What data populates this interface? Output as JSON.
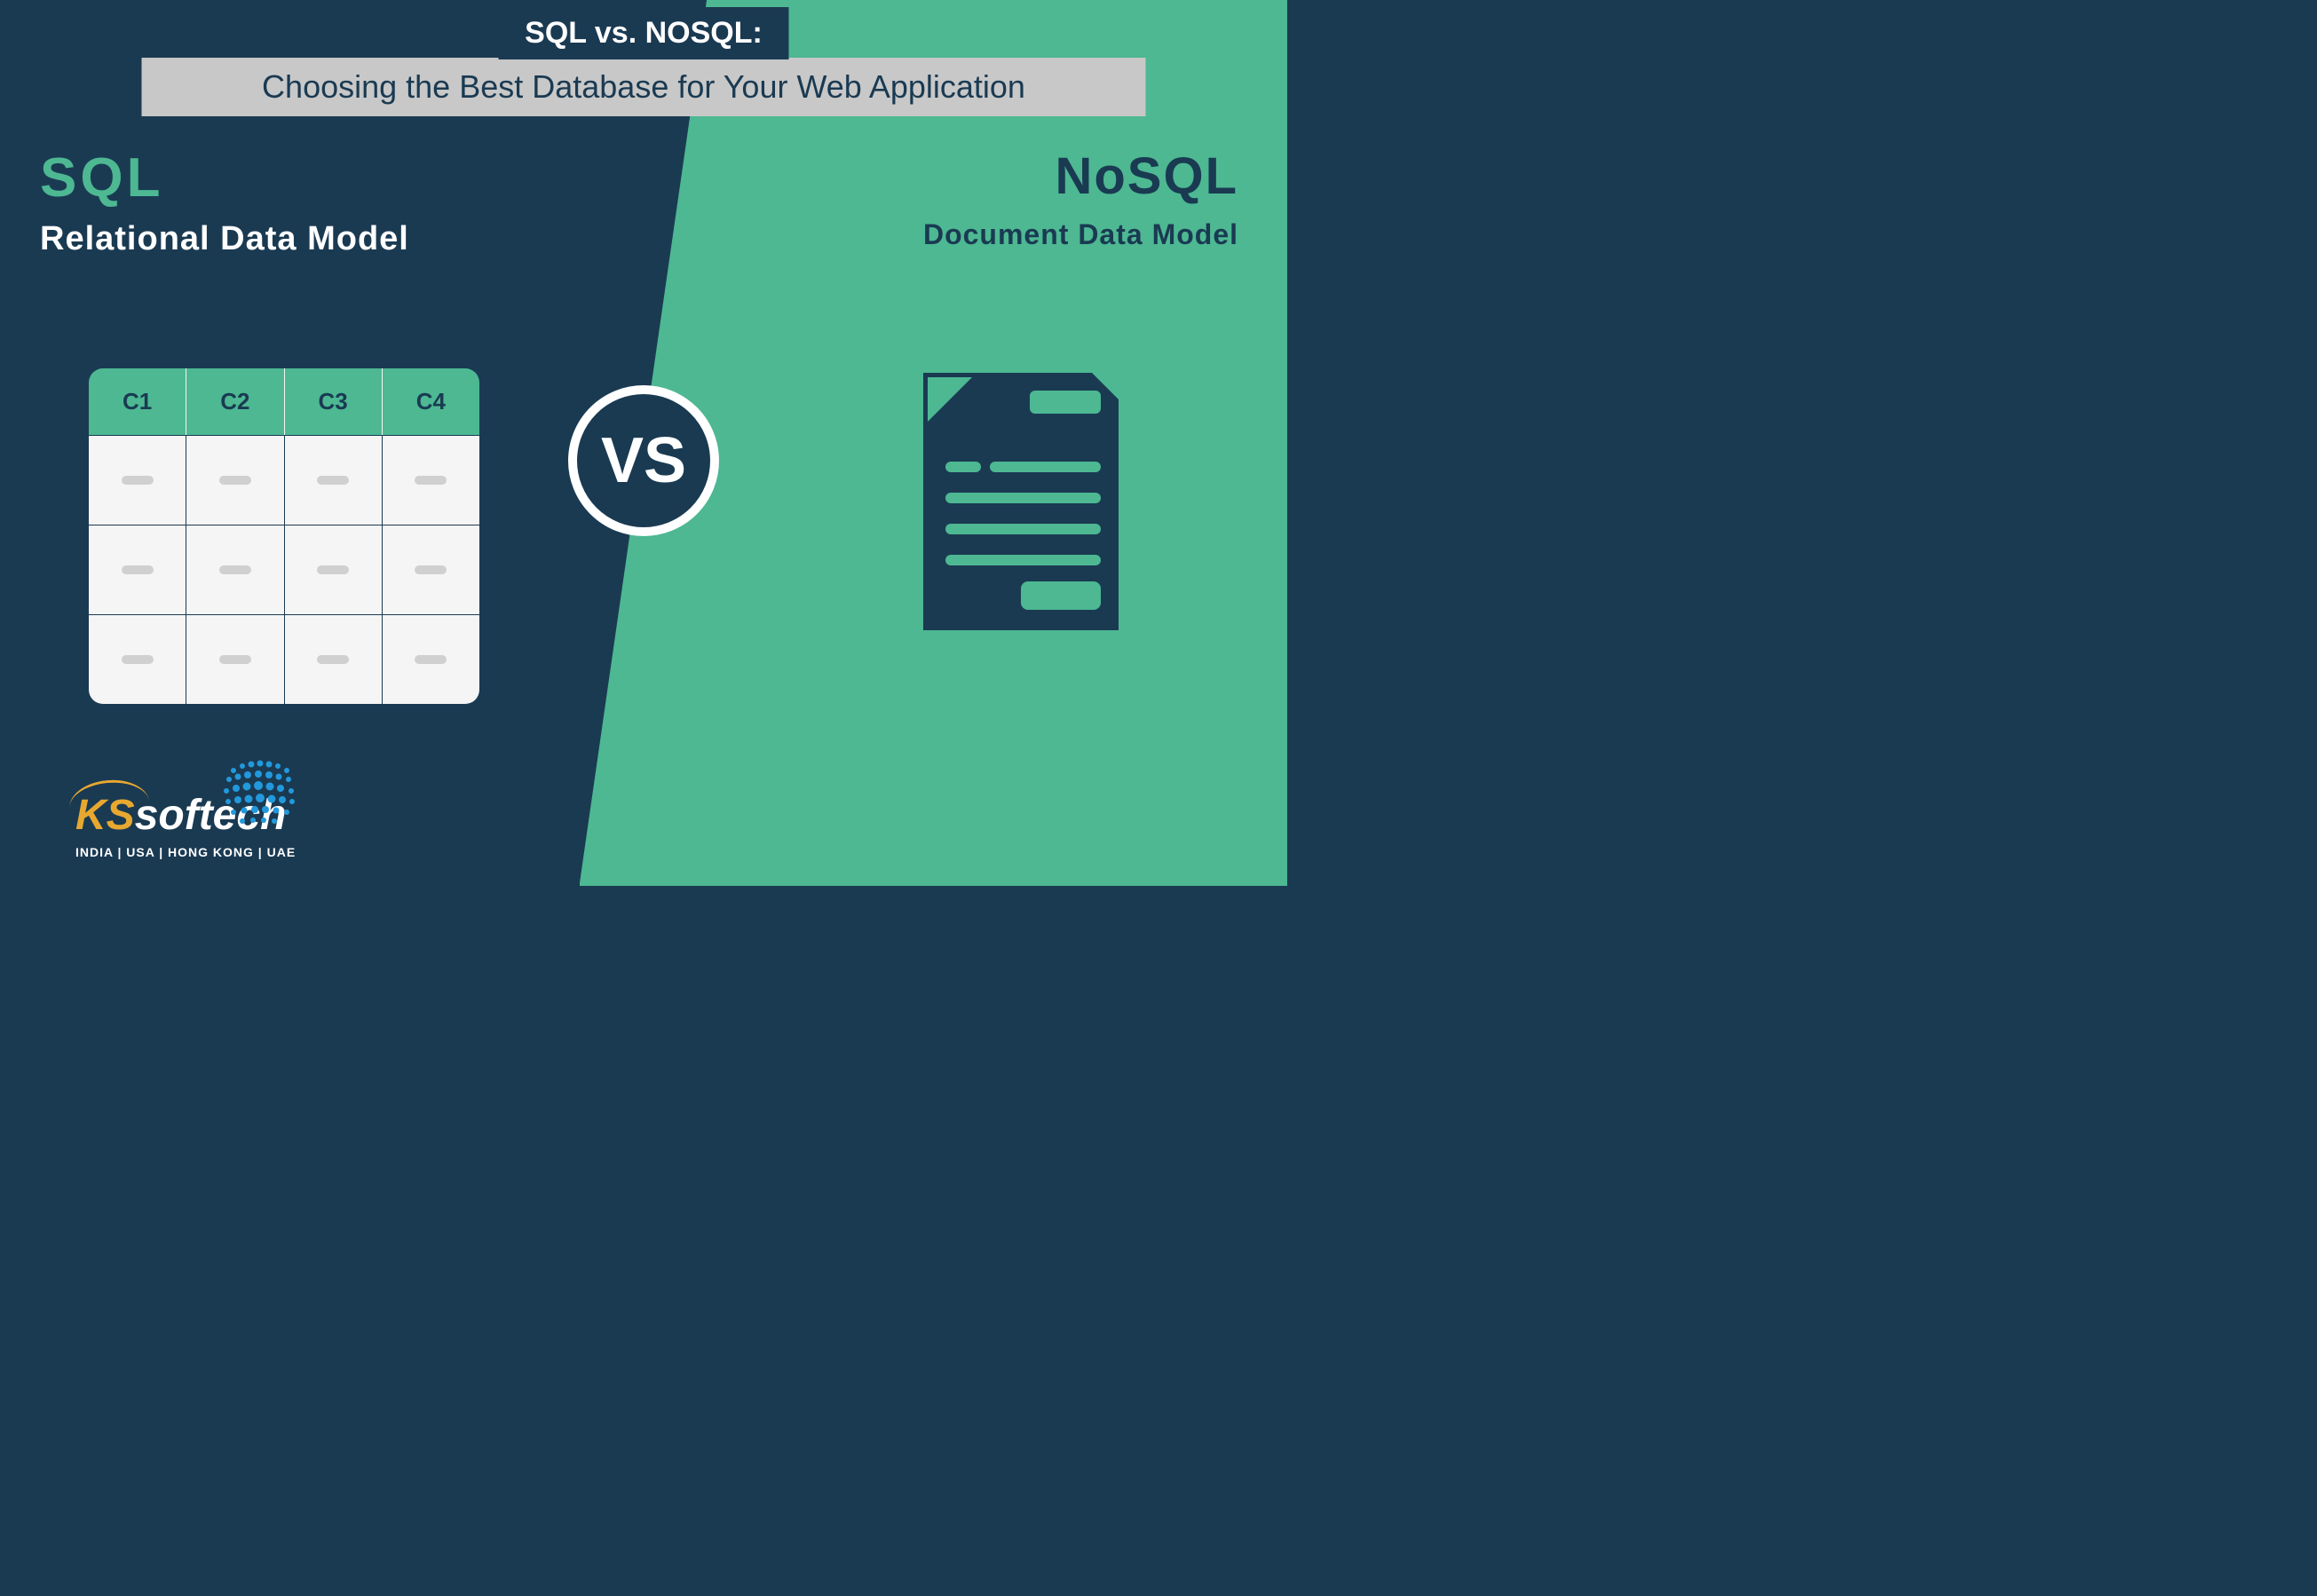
{
  "title": {
    "main": "SQL vs. NOSQL:",
    "subtitle": "Choosing the Best Database for Your Web Application"
  },
  "left": {
    "label": "SQL",
    "subtitle": "Relational Data Model",
    "table": {
      "columns": [
        "C1",
        "C2",
        "C3",
        "C4"
      ],
      "rows": 3
    }
  },
  "right": {
    "label": "NoSQL",
    "subtitle": "Document Data Model"
  },
  "vs": "VS",
  "logo": {
    "brand_k": "K",
    "brand_s": "S",
    "brand_rest": "softech",
    "locations": "INDIA | USA | HONG KONG | UAE"
  },
  "colors": {
    "dark_navy": "#1a3a52",
    "teal_green": "#4db892",
    "logo_orange": "#e8a830",
    "logo_blue": "#2299dd"
  }
}
